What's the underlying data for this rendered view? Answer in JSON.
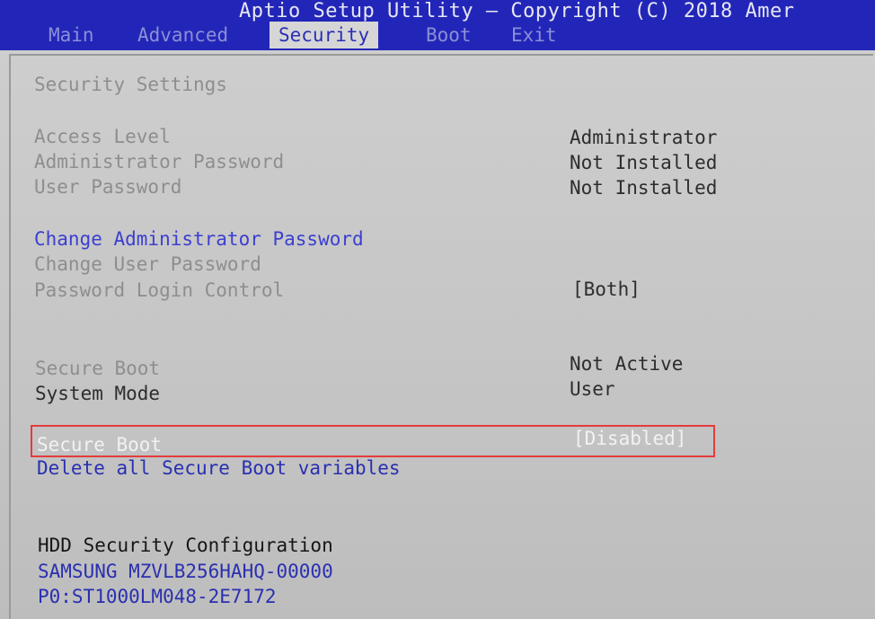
{
  "header": {
    "title": "Aptio Setup Utility – Copyright (C) 2018 Amer",
    "tabs": [
      {
        "label": "Main"
      },
      {
        "label": "Advanced"
      },
      {
        "label": "Security"
      },
      {
        "label": "Boot"
      },
      {
        "label": "Exit"
      }
    ],
    "active_tab": "Security"
  },
  "security": {
    "section_title": "Security Settings",
    "access_level": {
      "label": "Access Level",
      "value": "Administrator"
    },
    "admin_password": {
      "label": "Administrator Password",
      "value": "Not Installed"
    },
    "user_password": {
      "label": "User Password",
      "value": "Not Installed"
    },
    "change_admin_password": "Change Administrator Password",
    "change_user_password": "Change User Password",
    "password_login_control": {
      "label": "Password Login Control",
      "value": "[Both]"
    },
    "secure_boot_status": {
      "label": "Secure Boot",
      "value": "Not Active"
    },
    "system_mode": {
      "label": "System Mode",
      "value": "User"
    },
    "secure_boot_option": {
      "label": "Secure Boot",
      "value": "[Disabled]"
    },
    "delete_secure_boot_vars": "Delete all Secure Boot variables",
    "hdd_title": "HDD Security Configuration",
    "hdd_devices": [
      "SAMSUNG MZVLB256HAHQ-00000",
      "P0:ST1000LM048-2E7172"
    ]
  },
  "colors": {
    "header_bg": "#2226b8",
    "panel_bg": "#c9c9c9",
    "link_blue": "#3b3fd0",
    "highlight_border": "#e53b3b"
  }
}
